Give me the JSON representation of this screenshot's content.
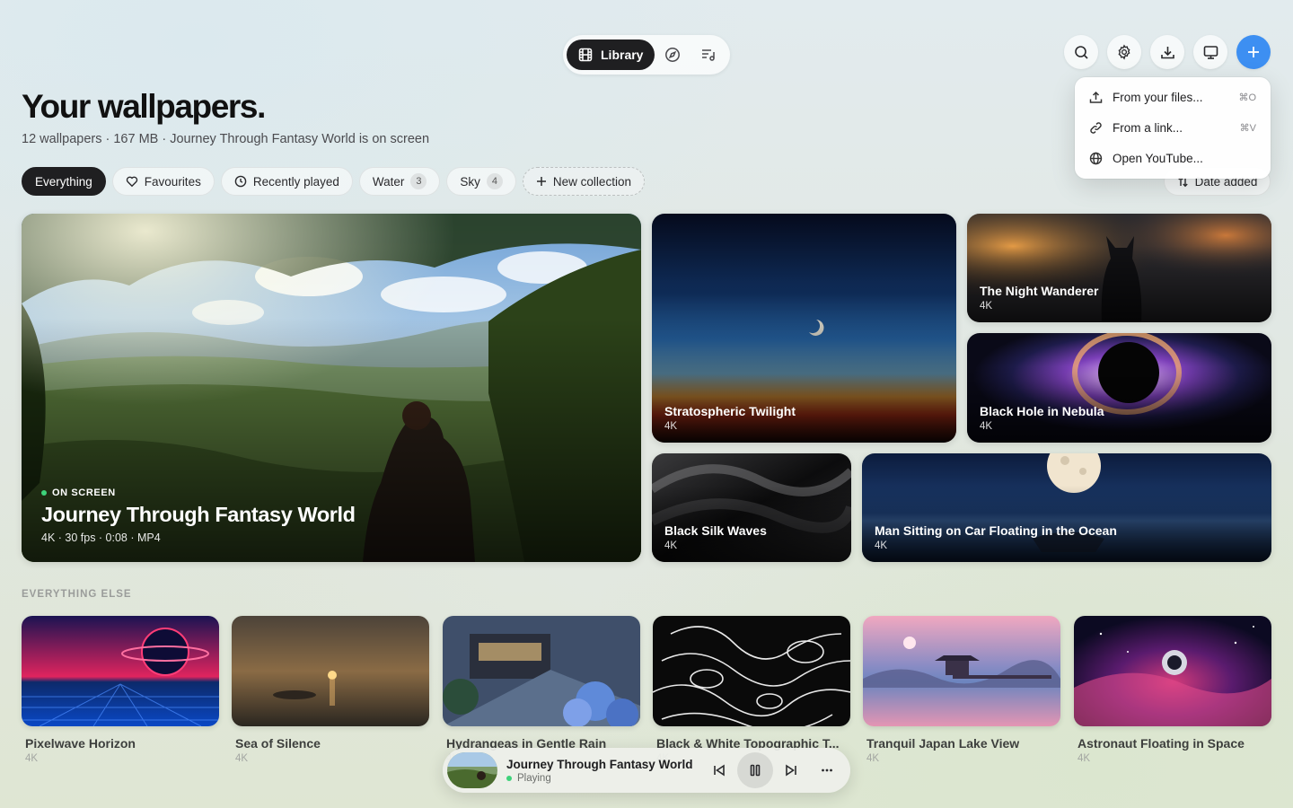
{
  "nav": {
    "library_label": "Library"
  },
  "menu": {
    "items": [
      {
        "label": "From your files...",
        "shortcut": "⌘O"
      },
      {
        "label": "From a link...",
        "shortcut": "⌘V"
      },
      {
        "label": "Open YouTube...",
        "shortcut": ""
      }
    ]
  },
  "header": {
    "title": "Your wallpapers.",
    "subtitle": "12 wallpapers · 167 MB · Journey Through Fantasy World is on screen"
  },
  "filters": {
    "everything": "Everything",
    "favourites": "Favourites",
    "recent": "Recently played",
    "water": {
      "label": "Water",
      "count": "3"
    },
    "sky": {
      "label": "Sky",
      "count": "4"
    },
    "new_collection": "New collection",
    "sort": "Date added"
  },
  "hero": {
    "badge": "ON SCREEN",
    "title": "Journey Through Fantasy World",
    "meta": "4K · 30 fps · 0:08 · MP4"
  },
  "featured": [
    {
      "name": "Stratospheric Twilight",
      "res": "4K"
    },
    {
      "name": "The Night Wanderer",
      "res": "4K"
    },
    {
      "name": "Black Hole in Nebula",
      "res": "4K"
    },
    {
      "name": "Black Silk Waves",
      "res": "4K"
    },
    {
      "name": "Man Sitting on Car Floating in the Ocean",
      "res": "4K"
    }
  ],
  "section_label": "EVERYTHING ELSE",
  "others": [
    {
      "name": "Pixelwave Horizon",
      "res": "4K"
    },
    {
      "name": "Sea of Silence",
      "res": "4K"
    },
    {
      "name": "Hydrangeas in Gentle Rain",
      "res": "4K"
    },
    {
      "name": "Black & White Topographic T...",
      "res": "4K"
    },
    {
      "name": "Tranquil Japan Lake View",
      "res": "4K"
    },
    {
      "name": "Astronaut Floating in Space",
      "res": "4K"
    }
  ],
  "player": {
    "title": "Journey Through Fantasy World",
    "status": "Playing"
  },
  "colors": {
    "accent": "#3d8ff2",
    "playing": "#3ed27a",
    "dark_chip": "#1f1f21"
  }
}
